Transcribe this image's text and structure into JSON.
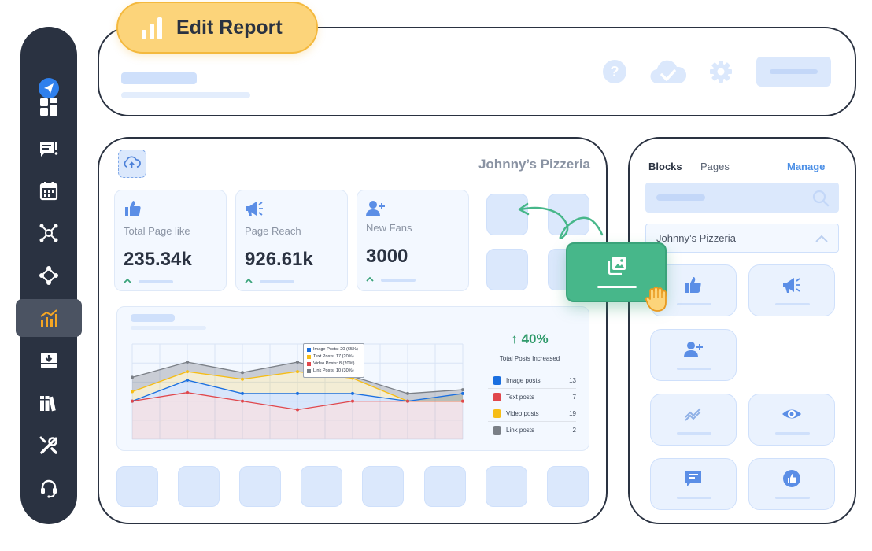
{
  "header": {
    "title": "Edit Report",
    "icons": [
      "help-icon",
      "cloud-check-icon",
      "gear-icon"
    ]
  },
  "sidebar": {
    "items": [
      {
        "icon": "send-icon"
      },
      {
        "icon": "dashboard-icon"
      },
      {
        "icon": "feedback-icon"
      },
      {
        "icon": "calendar-icon"
      },
      {
        "icon": "network-icon"
      },
      {
        "icon": "nodes-icon"
      },
      {
        "icon": "analytics-icon",
        "active": true
      },
      {
        "icon": "inbox-download-icon"
      },
      {
        "icon": "library-icon"
      },
      {
        "icon": "tools-icon"
      },
      {
        "icon": "headset-icon"
      }
    ]
  },
  "report": {
    "brand": "Johnny’s Pizzeria",
    "stats": [
      {
        "label": "Total Page like",
        "value": "235.34k",
        "icon": "thumbs-up-icon"
      },
      {
        "label": "Page Reach",
        "value": "926.61k",
        "icon": "megaphone-icon"
      },
      {
        "label": "New Fans",
        "value": "3000",
        "icon": "add-user-icon"
      }
    ],
    "summary": {
      "change": "↑ 40%",
      "caption": "Total Posts Increased"
    },
    "legend": [
      {
        "name": "Image posts",
        "count": "13",
        "color": "#1a6fe0"
      },
      {
        "name": "Text posts",
        "count": "7",
        "color": "#e0474c"
      },
      {
        "name": "Video posts",
        "count": "19",
        "color": "#f6bd16"
      },
      {
        "name": "Link posts",
        "count": "2",
        "color": "#7a7f86"
      }
    ],
    "tooltip": [
      {
        "text": "Image Posts: 20 (65%)",
        "color": "#1a6fe0"
      },
      {
        "text": "Text Posts: 17 (20%)",
        "color": "#f6bd16"
      },
      {
        "text": "Video Posts: 8 (20%)",
        "color": "#e0474c"
      },
      {
        "text": "Link Posts: 10 (30%)",
        "color": "#7a7f86"
      }
    ]
  },
  "chart_data": {
    "type": "area",
    "x": [
      1,
      2,
      3,
      4,
      5,
      6,
      7
    ],
    "ylim": [
      0,
      10
    ],
    "series": [
      {
        "values": [
          6.5,
          8.1,
          7.0,
          8.1,
          6.6,
          4.8,
          5.2
        ],
        "color": "#7a7f86"
      },
      {
        "values": [
          5.0,
          7.1,
          6.3,
          7.1,
          6.4,
          4.0,
          4.0
        ],
        "color": "#f6bd16"
      },
      {
        "values": [
          4.0,
          6.2,
          4.8,
          4.8,
          4.8,
          4.0,
          4.8
        ],
        "color": "#1a6fe0"
      },
      {
        "values": [
          4.0,
          4.9,
          4.0,
          3.1,
          4.0,
          4.0,
          4.0
        ],
        "color": "#e0474c"
      }
    ],
    "grid": true
  },
  "blocks_panel": {
    "tabs": [
      "Blocks",
      "Pages"
    ],
    "manage": "Manage",
    "selected_page": "Johnny’s Pizzeria",
    "blocks": [
      "thumbs-up-icon",
      "megaphone-icon",
      "add-user-icon",
      "trend-icon",
      "eye-icon",
      "comment-icon",
      "like-circle-icon"
    ]
  },
  "drag_item": {
    "icon": "image-gallery-icon"
  }
}
